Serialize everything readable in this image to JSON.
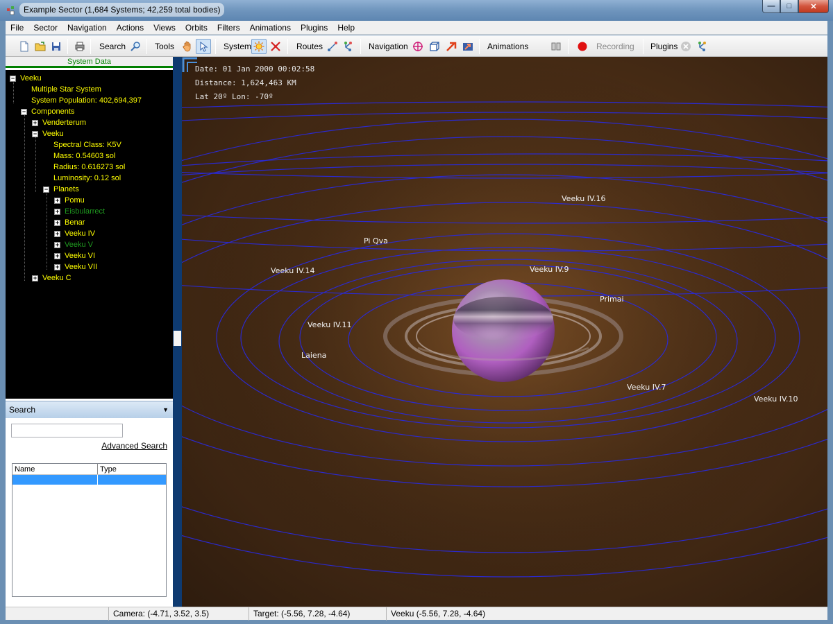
{
  "window": {
    "title": "Example Sector (1,684 Systems; 42,259 total bodies)",
    "minimize_icon": "minimize-icon",
    "maximize_icon": "maximize-icon",
    "close_icon": "close-icon"
  },
  "menu": [
    "File",
    "Sector",
    "Navigation",
    "Actions",
    "Views",
    "Orbits",
    "Filters",
    "Animations",
    "Plugins",
    "Help"
  ],
  "toolbar": {
    "search_label": "Search",
    "tools_label": "Tools",
    "system_label": "System",
    "routes_label": "Routes",
    "navigation_label": "Navigation",
    "animations_label": "Animations",
    "recording_label": "Recording",
    "plugins_label": "Plugins"
  },
  "system_data": {
    "header": "System Data",
    "tree": [
      {
        "label": "Veeku",
        "level": 0,
        "toggle": "-",
        "color": "yellow"
      },
      {
        "label": "Multiple Star System",
        "level": 1,
        "toggle": "",
        "color": "yellow"
      },
      {
        "label": "System Population: 402,694,397",
        "level": 1,
        "toggle": "",
        "color": "yellow"
      },
      {
        "label": "Components",
        "level": 1,
        "toggle": "-",
        "color": "yellow"
      },
      {
        "label": "Venderterum",
        "level": 2,
        "toggle": "+",
        "color": "yellow"
      },
      {
        "label": "Veeku",
        "level": 2,
        "toggle": "-",
        "color": "yellow"
      },
      {
        "label": "Spectral Class: K5V",
        "level": 3,
        "toggle": "",
        "color": "yellow"
      },
      {
        "label": "Mass: 0.54603 sol",
        "level": 3,
        "toggle": "",
        "color": "yellow"
      },
      {
        "label": "Radius: 0.616273 sol",
        "level": 3,
        "toggle": "",
        "color": "yellow"
      },
      {
        "label": "Luminosity: 0.12 sol",
        "level": 3,
        "toggle": "",
        "color": "yellow"
      },
      {
        "label": "Planets",
        "level": 3,
        "toggle": "-",
        "color": "yellow"
      },
      {
        "label": "Pomu",
        "level": 4,
        "toggle": "+",
        "color": "yellow"
      },
      {
        "label": "Eisbularrect",
        "level": 4,
        "toggle": "+",
        "color": "green"
      },
      {
        "label": "Benar",
        "level": 4,
        "toggle": "+",
        "color": "yellow"
      },
      {
        "label": "Veeku IV",
        "level": 4,
        "toggle": "+",
        "color": "yellow"
      },
      {
        "label": "Veeku V",
        "level": 4,
        "toggle": "+",
        "color": "green"
      },
      {
        "label": "Veeku VI",
        "level": 4,
        "toggle": "+",
        "color": "yellow"
      },
      {
        "label": "Veeku VII",
        "level": 4,
        "toggle": "+",
        "color": "yellow"
      },
      {
        "label": "Veeku C",
        "level": 2,
        "toggle": "+",
        "color": "yellow"
      }
    ]
  },
  "search": {
    "header": "Search",
    "value": "",
    "advanced_link": "Advanced Search",
    "columns": [
      "Name",
      "Type"
    ]
  },
  "view": {
    "date": "Date: 01 Jan 2000 00:02:58",
    "distance": "Distance: 1,624,463 KM",
    "latlon": "Lat 20º Lon: -70º",
    "labels": [
      "Veeku IV.16",
      "Pi Qva",
      "Veeku IV.14",
      "Veeku IV.9",
      "Primai",
      "Veeku IV.11",
      "Laiena",
      "Veeku IV.7",
      "Veeku IV.10"
    ]
  },
  "status": {
    "camera": "Camera: (-4.71, 3.52, 3.5)",
    "target": "Target: (-5.56, 7.28, -4.64)",
    "selected": "Veeku (-5.56, 7.28, -4.64)"
  }
}
